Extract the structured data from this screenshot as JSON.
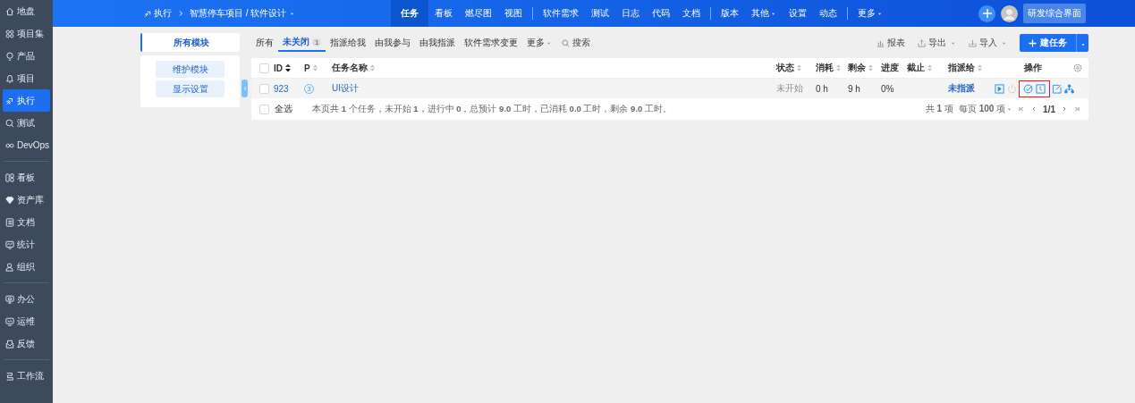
{
  "sidebar": {
    "groups": [
      [
        {
          "label": "地盘",
          "selected": false
        },
        {
          "label": "项目集",
          "selected": false
        },
        {
          "label": "产品",
          "selected": false
        },
        {
          "label": "项目",
          "selected": false
        },
        {
          "label": "执行",
          "selected": true
        },
        {
          "label": "测试",
          "selected": false
        },
        {
          "label": "DevOps",
          "selected": false
        }
      ],
      [
        {
          "label": "看板",
          "selected": false
        },
        {
          "label": "资产库",
          "selected": false
        },
        {
          "label": "文档",
          "selected": false
        },
        {
          "label": "统计",
          "selected": false
        },
        {
          "label": "组织",
          "selected": false
        }
      ],
      [
        {
          "label": "办公",
          "selected": false
        },
        {
          "label": "运维",
          "selected": false
        },
        {
          "label": "反馈",
          "selected": false
        }
      ],
      [
        {
          "label": "工作流",
          "selected": false
        }
      ]
    ]
  },
  "topbar": {
    "breadcrumb": {
      "section": "执行",
      "path": "智慧停车项目 / 软件设计"
    },
    "nav": [
      [
        {
          "label": "任务",
          "selected": true,
          "dropdown": false
        },
        {
          "label": "看板",
          "selected": false,
          "dropdown": false
        },
        {
          "label": "燃尽图",
          "selected": false,
          "dropdown": false
        },
        {
          "label": "视图",
          "selected": false,
          "dropdown": false
        }
      ],
      [
        {
          "label": "软件需求",
          "selected": false,
          "dropdown": false
        },
        {
          "label": "测试",
          "selected": false,
          "dropdown": false
        },
        {
          "label": "日志",
          "selected": false,
          "dropdown": false
        },
        {
          "label": "代码",
          "selected": false,
          "dropdown": false
        },
        {
          "label": "文档",
          "selected": false,
          "dropdown": false
        }
      ],
      [
        {
          "label": "版本",
          "selected": false,
          "dropdown": false
        },
        {
          "label": "其他",
          "selected": false,
          "dropdown": true
        },
        {
          "label": "设置",
          "selected": false,
          "dropdown": false
        },
        {
          "label": "动态",
          "selected": false,
          "dropdown": false
        }
      ],
      [
        {
          "label": "更多",
          "selected": false,
          "dropdown": true
        }
      ]
    ],
    "switch_button": "研发综合界面"
  },
  "module_panel": {
    "tab": "所有模块",
    "buttons": [
      "维护模块",
      "显示设置"
    ]
  },
  "filters": {
    "tabs": [
      {
        "label": "所有",
        "selected": false,
        "dropdown": false
      },
      {
        "label": "未关闭",
        "selected": true,
        "dropdown": false,
        "count": "1"
      },
      {
        "label": "指派给我",
        "selected": false,
        "dropdown": false
      },
      {
        "label": "由我参与",
        "selected": false,
        "dropdown": false
      },
      {
        "label": "由我指派",
        "selected": false,
        "dropdown": false
      },
      {
        "label": "软件需求变更",
        "selected": false,
        "dropdown": false
      },
      {
        "label": "更多",
        "selected": false,
        "dropdown": true
      }
    ],
    "search": "搜索"
  },
  "toolbar": {
    "report": "报表",
    "export": "导出",
    "import": "导入",
    "create": "建任务"
  },
  "table": {
    "header_checked": false,
    "columns": [
      {
        "label": "ID",
        "sortable": true,
        "sorted": true
      },
      {
        "label": "P",
        "sortable": true,
        "sorted": false
      },
      {
        "label": "任务名称",
        "sortable": true,
        "sorted": false
      },
      {
        "label": "状态",
        "sortable": true,
        "sorted": false
      },
      {
        "label": "消耗",
        "sortable": true,
        "sorted": false
      },
      {
        "label": "剩余",
        "sortable": true,
        "sorted": false
      },
      {
        "label": "进度",
        "sortable": false
      },
      {
        "label": "截止",
        "sortable": true,
        "sorted": false
      },
      {
        "label": "指派给",
        "sortable": true,
        "sorted": false
      },
      {
        "label": "操作",
        "sortable": false
      }
    ],
    "rows": [
      {
        "checked": false,
        "id": "923",
        "priority": "3",
        "name": "UI设计",
        "status": "未开始",
        "consumed": "0 h",
        "left": "9 h",
        "progress": "0%",
        "assigned": "未指派",
        "actions": [
          {
            "kind": "start",
            "disabled": false,
            "highlighted": false
          },
          {
            "kind": "pause",
            "disabled": true,
            "highlighted": false
          },
          {
            "kind": "finish",
            "disabled": false,
            "highlighted": true
          },
          {
            "kind": "record",
            "disabled": false,
            "highlighted": true
          },
          {
            "kind": "edit",
            "disabled": false,
            "highlighted": false
          },
          {
            "kind": "split",
            "disabled": false,
            "highlighted": false
          }
        ]
      }
    ],
    "footer": {
      "select_all": "全选",
      "select_all_checked": false,
      "summary": "本页共 **1** 个任务，未开始 **1**，进行中 **0**，总预计 **9.0** 工时，已消耗 **0.0** 工时，剩余 **9.0** 工时。",
      "total": "共 **1** 项",
      "per_page": "每页 **100** 项",
      "page": "1/1"
    }
  }
}
